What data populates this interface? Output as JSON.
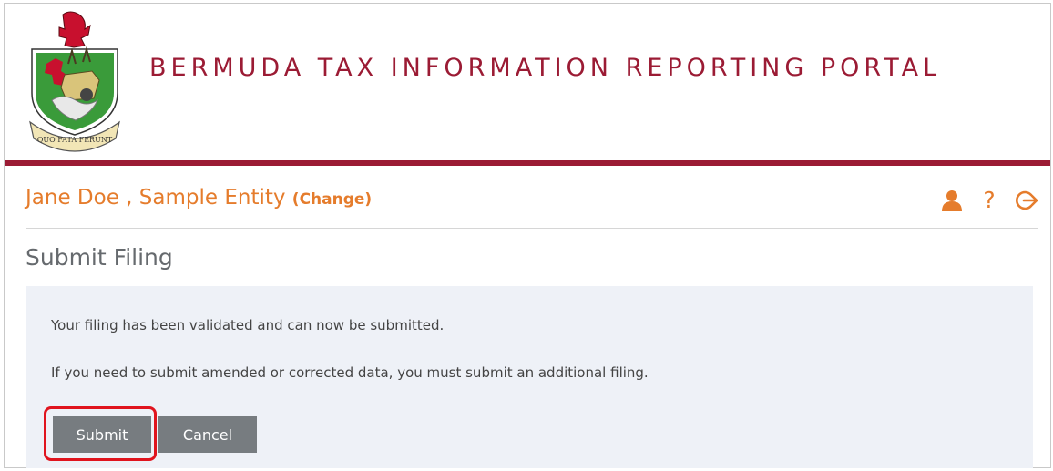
{
  "portal": {
    "title": "BERMUDA TAX INFORMATION REPORTING PORTAL",
    "crest_motto": "QUO FATA FERUNT"
  },
  "user": {
    "display": "Jane Doe , Sample Entity ",
    "change_label": "(Change)"
  },
  "toolbar": {
    "icons": [
      "user-icon",
      "help-icon",
      "logout-icon"
    ],
    "help_glyph": "?"
  },
  "page": {
    "title": "Submit Filing",
    "messages": [
      "Your filing has been validated and can now be submitted.",
      "If you need to submit amended or corrected data, you must submit an additional filing."
    ],
    "buttons": {
      "submit": "Submit",
      "cancel": "Cancel"
    }
  },
  "colors": {
    "brand": "#9b1b34",
    "accent": "#e57c2c",
    "panel": "#eef1f7",
    "button": "#777c80",
    "highlight": "#e0141e"
  }
}
